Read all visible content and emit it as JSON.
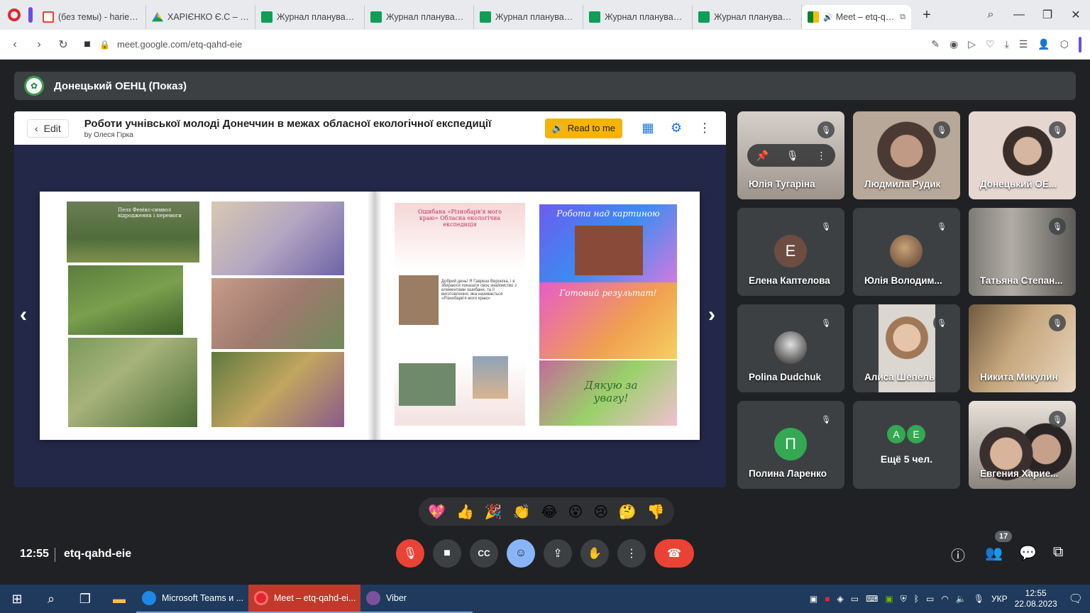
{
  "browser": {
    "tabs": [
      {
        "label": "(без темы) - harienko2",
        "icon_color": "#ea4335",
        "icon": "gmail-icon"
      },
      {
        "label": "ХАРІЄНКО Є.С – Googl",
        "icon_color": "#fbbc04",
        "icon": "drive-icon"
      },
      {
        "label": "Журнал планування та",
        "icon_color": "#0f9d58",
        "icon": "sheets-icon"
      },
      {
        "label": "Журнал планування та",
        "icon_color": "#0f9d58",
        "icon": "sheets-icon"
      },
      {
        "label": "Журнал планування та",
        "icon_color": "#0f9d58",
        "icon": "sheets-icon"
      },
      {
        "label": "Журнал планування та",
        "icon_color": "#0f9d58",
        "icon": "sheets-icon"
      },
      {
        "label": "Журнал планування та",
        "icon_color": "#0f9d58",
        "icon": "sheets-icon"
      },
      {
        "label": "Meet – etq-qahd-ei",
        "icon_color": "#00897b",
        "icon": "meet-icon",
        "active": true
      }
    ],
    "url": "meet.google.com/etq-qahd-eie"
  },
  "meeting": {
    "header_title": "Донецький ОЕНЦ (Показ)",
    "presentation": {
      "edit_label": "Edit",
      "title": "Роботи учнівської молоді Донеччин в межах обласної екологічної експедиції",
      "author": "by Олеся Гірка",
      "read_label": "Read to me",
      "slide_texts": {
        "phoenix": "Пелх Фенікс-символ відродження і перемоги",
        "oshibana": "Ошибана «Різнобарв'я мого краю» Обласна екологічна експедиція",
        "greeting": "Добрий день! Я Гаврюш Вероніка, і я збираюся показати своє знайомство з елементами ошибани, та її виготовлення, яка називається «Різнобарв'я мого краю»",
        "work_title": "Робота над картиною",
        "result_title": "Готовий результат!",
        "thanks": "Дякую за увагу!"
      }
    },
    "participants": [
      {
        "name": "Юлія Тугаріна",
        "bg": "#b9b1a8",
        "hover": true
      },
      {
        "name": "Людмила Рудик",
        "bg": "#7a6a5c"
      },
      {
        "name": "Донецький ОЕ...",
        "bg": "#c9b9b0"
      },
      {
        "name": "Елена Каптелова",
        "bg": "#3c4043",
        "avatar_letter": "Е",
        "avatar_color": "#6d4c41"
      },
      {
        "name": "Юлія Володим...",
        "bg": "#3c4043",
        "avatar_photo": true
      },
      {
        "name": "Татьяна Степан...",
        "bg": "#8b8a87"
      },
      {
        "name": "Polina Dudchuk",
        "bg": "#3c4043",
        "avatar_photo": true,
        "avatar_dark": true
      },
      {
        "name": "Алиса Шепель",
        "bg": "#a89a8e"
      },
      {
        "name": "Никита Микулин",
        "bg": "#9b8a70"
      },
      {
        "name": "Полина Ларенко",
        "bg": "#3c4043",
        "avatar_letter": "П",
        "avatar_color": "#34a853"
      },
      {
        "name": "Ещё 5 чел.",
        "bg": "#3c4043",
        "more": true,
        "letters": [
          "А",
          "Е"
        ]
      },
      {
        "name": "Евгения Харие...",
        "bg": "#6f6a64"
      }
    ],
    "reactions": [
      "💖",
      "👍",
      "🎉",
      "👏",
      "😂",
      "😮",
      "😢",
      "🤔",
      "👎"
    ],
    "clock": "12:55",
    "code": "etq-qahd-eie",
    "people_count": "17"
  },
  "taskbar": {
    "apps": [
      {
        "label": "Microsoft Teams и ...",
        "color": "#1e88e5"
      },
      {
        "label": "Meet – etq-qahd-ei...",
        "color": "#c0392b",
        "active": true
      },
      {
        "label": "Viber",
        "color": "#7b519d"
      }
    ],
    "lang": "УКР",
    "time": "12:55",
    "date": "22.08.2023"
  }
}
